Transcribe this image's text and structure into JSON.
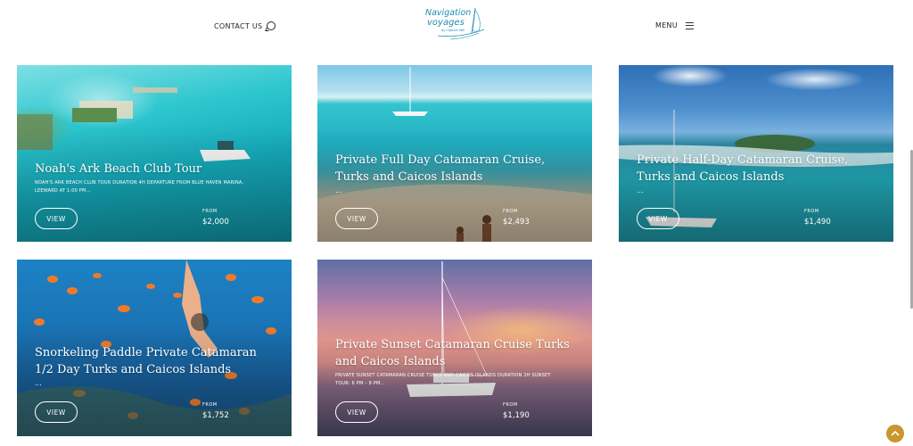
{
  "header": {
    "contact_label": "CONTACT US",
    "logo_line1": "Navigation",
    "logo_line2": "voyages",
    "logo_line3": "by Captain Will",
    "menu_label": "MENU"
  },
  "tours": [
    {
      "title": "Noah's Ark Beach Club Tour",
      "description": "NOAH'S ARK BEACH CLUB TOUR DURATION 4H DEPARTURE FROM BLUE HAVEN MARINA, LEEWARD AT 1:00 PM...",
      "view_label": "VIEW",
      "from_label": "FROM",
      "price": "$2,000"
    },
    {
      "title": "Private Full Day Catamaran Cruise, Turks and Caicos Islands",
      "description": "...",
      "view_label": "VIEW",
      "from_label": "FROM",
      "price": "$2,493"
    },
    {
      "title": "Private Half-Day Catamaran Cruise, Turks and Caicos Islands",
      "description": "...",
      "view_label": "VIEW",
      "from_label": "FROM",
      "price": "$1,490"
    },
    {
      "title": "Snorkeling Paddle Private Catamaran 1/2 Day Turks and Caicos Islands",
      "description": "...",
      "view_label": "VIEW",
      "from_label": "FROM",
      "price": "$1,752"
    },
    {
      "title": "Private Sunset Catamaran Cruise Turks and Caicos Islands",
      "description": "PRIVATE SUNSET CATAMARAN CRUISE TURKS AND CAICOS ISLANDS DURATION 2H SUNSET TOUR: 6 PM – 8 PM...",
      "view_label": "VIEW",
      "from_label": "FROM",
      "price": "$1,190"
    }
  ],
  "colors": {
    "logo": "#1d8fb0",
    "back_to_top": "#c9962f"
  },
  "icons": {
    "contact": "chat-bubble-icon",
    "menu": "hamburger-icon",
    "back_to_top": "chevron-up-icon"
  }
}
